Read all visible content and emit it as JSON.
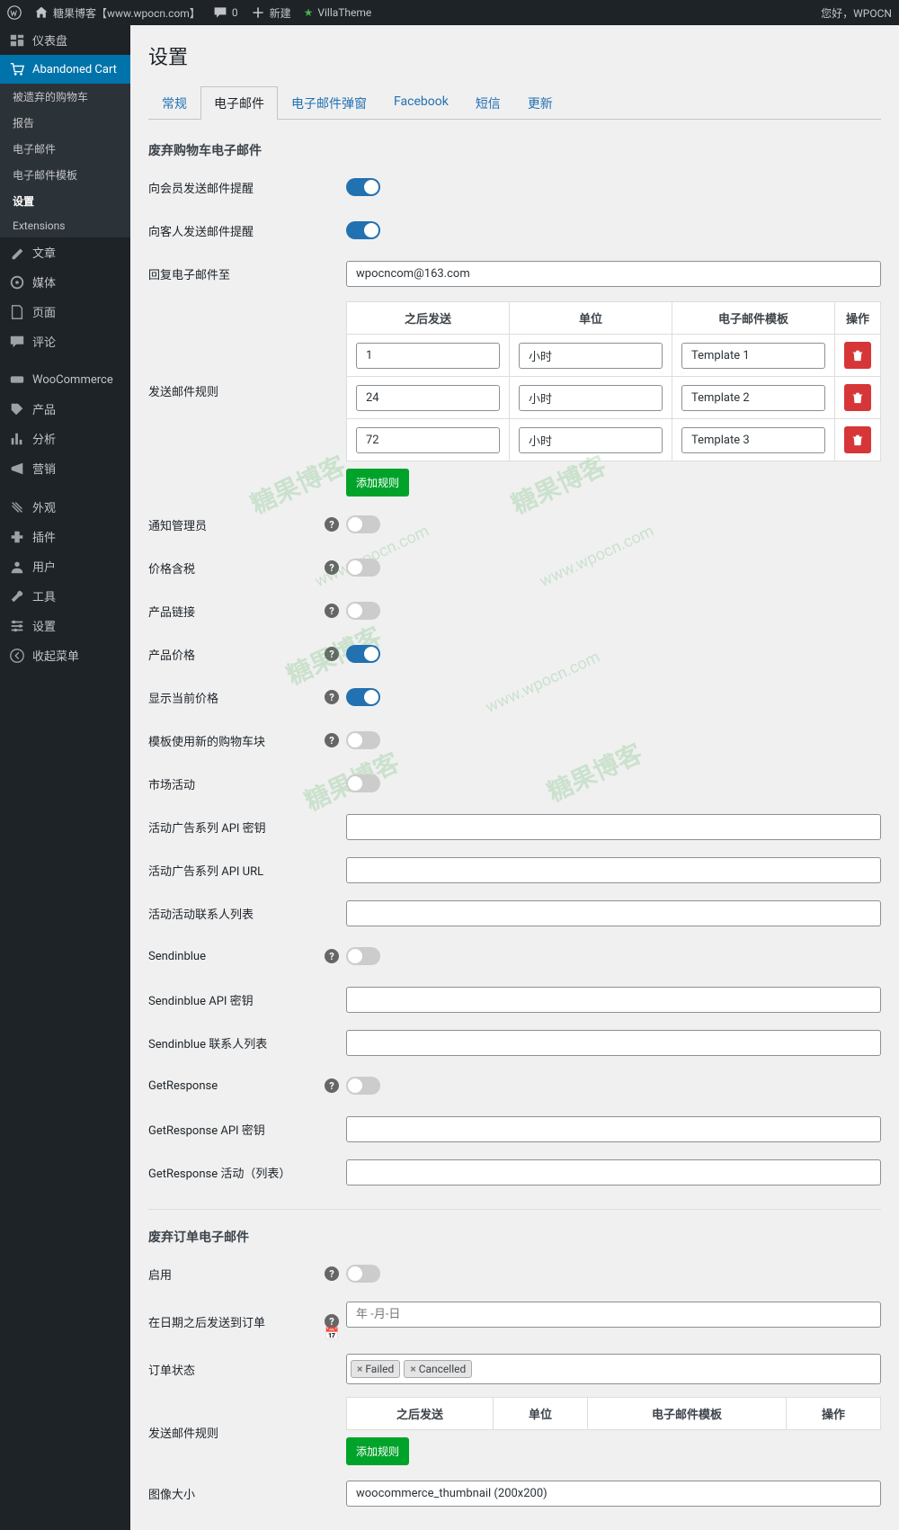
{
  "adminbar": {
    "site_name": "糖果博客【www.wpocn.com】",
    "comments": "0",
    "new": "新建",
    "theme": "VillaTheme",
    "greeting": "您好，WPOCN"
  },
  "sidebar": {
    "dashboard": "仪表盘",
    "abandoned_cart": "Abandoned Cart",
    "submenu": {
      "abandoned": "被遗弃的购物车",
      "report": "报告",
      "email": "电子邮件",
      "email_template": "电子邮件模板",
      "settings": "设置",
      "extensions": "Extensions"
    },
    "posts": "文章",
    "media": "媒体",
    "pages": "页面",
    "comments": "评论",
    "woocommerce": "WooCommerce",
    "products": "产品",
    "analytics": "分析",
    "marketing": "营销",
    "appearance": "外观",
    "plugins": "插件",
    "users": "用户",
    "tools": "工具",
    "settings": "设置",
    "collapse": "收起菜单"
  },
  "page": {
    "title": "设置"
  },
  "tabs": {
    "general": "常规",
    "email": "电子邮件",
    "popup": "电子邮件弹窗",
    "facebook": "Facebook",
    "sms": "短信",
    "update": "更新"
  },
  "section_cart": {
    "title": "废弃购物车电子邮件",
    "send_member": "向会员发送邮件提醒",
    "send_guest": "向客人发送邮件提醒",
    "reply_to": "回复电子邮件至",
    "reply_to_value": "wpocncom@163.com",
    "rules_label": "发送邮件规则",
    "table": {
      "col_after": "之后发送",
      "col_unit": "单位",
      "col_template": "电子邮件模板",
      "col_action": "操作",
      "rows": [
        {
          "after": "1",
          "unit": "小时",
          "template": "Template 1"
        },
        {
          "after": "24",
          "unit": "小时",
          "template": "Template 2"
        },
        {
          "after": "72",
          "unit": "小时",
          "template": "Template 3"
        }
      ]
    },
    "add_rule": "添加规则",
    "notify_admin": "通知管理员",
    "price_tax": "价格含税",
    "product_link": "产品链接",
    "product_price": "产品价格",
    "show_current_price": "显示当前价格",
    "use_new_cart_block": "模板使用新的购物车块",
    "campaign": "市场活动",
    "api_key": "活动广告系列 API 密钥",
    "api_url": "活动广告系列 API URL",
    "contact_list": "活动活动联系人列表",
    "sendinblue": "Sendinblue",
    "sendinblue_api": "Sendinblue API 密钥",
    "sendinblue_list": "Sendinblue 联系人列表",
    "getresponse": "GetResponse",
    "getresponse_api": "GetResponse API 密钥",
    "getresponse_campaign": "GetResponse 活动（列表）"
  },
  "section_order": {
    "title": "废弃订单电子邮件",
    "enable": "启用",
    "send_after_date": "在日期之后发送到订单",
    "date_placeholder": "年 -月-日",
    "order_status": "订单状态",
    "status_failed": "Failed",
    "status_cancelled": "Cancelled",
    "rules_label": "发送邮件规则",
    "table": {
      "col_after": "之后发送",
      "col_unit": "单位",
      "col_template": "电子邮件模板",
      "col_action": "操作"
    },
    "add_rule": "添加规则",
    "image_size": "图像大小",
    "image_size_value": "woocommerce_thumbnail (200x200)"
  },
  "watermarks": {
    "text": "糖果博客",
    "url": "www.wpocn.com"
  }
}
